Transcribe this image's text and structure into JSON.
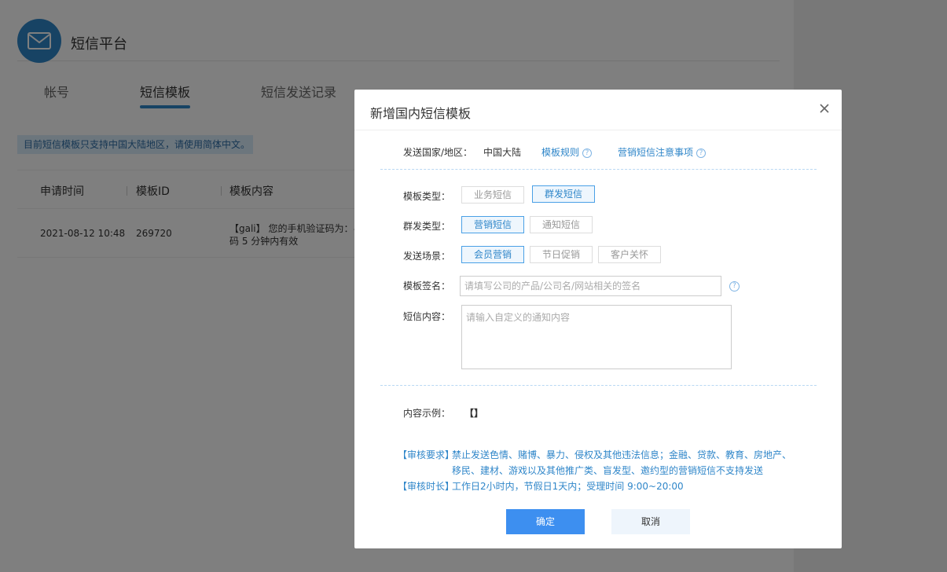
{
  "app": {
    "title": "短信平台"
  },
  "tabs": [
    {
      "label": "帐号"
    },
    {
      "label": "短信模板"
    },
    {
      "label": "短信发送记录"
    }
  ],
  "notice": "目前短信模板只支持中国大陆地区，请使用简体中文。",
  "table": {
    "headers": [
      "申请时间",
      "模板ID",
      "模板内容"
    ],
    "rows": [
      {
        "time": "2021-08-12 10:48",
        "id": "269720",
        "content_line1": "【gali】 您的手机验证码为：#",
        "content_line2": "码 5 分钟内有效"
      }
    ]
  },
  "modal": {
    "title": "新增国内短信模板",
    "country_label": "发送国家/地区：",
    "country_value": "中国大陆",
    "rule_link": "模板规则",
    "marketing_link": "营销短信注意事项",
    "template_type_label": "模板类型：",
    "template_type_options": [
      "业务短信",
      "群发短信"
    ],
    "group_type_label": "群发类型：",
    "group_type_options": [
      "营销短信",
      "通知短信"
    ],
    "scene_label": "发送场景：",
    "scene_options": [
      "会员营销",
      "节日促销",
      "客户关怀"
    ],
    "signature_label": "模板签名：",
    "signature_placeholder": "请填写公司的产品/公司名/网站相关的签名",
    "content_label": "短信内容：",
    "content_placeholder": "请输入自定义的通知内容",
    "example_label": "内容示例：",
    "example_value": "【】",
    "review_req_tag": "【审核要求】",
    "review_req_line1": "禁止发送色情、赌博、暴力、侵权及其他违法信息；金融、贷款、教育、房地产、",
    "review_req_line2": "移民、建材、游戏以及其他推广类、盲发型、邀约型的营销短信不支持发送",
    "review_time_tag": "【审核时长】",
    "review_time_text": "工作日2小时内，节假日1天内；受理时间 9:00~20:00",
    "confirm_label": "确定",
    "cancel_label": "取消",
    "help_glyph": "?"
  }
}
